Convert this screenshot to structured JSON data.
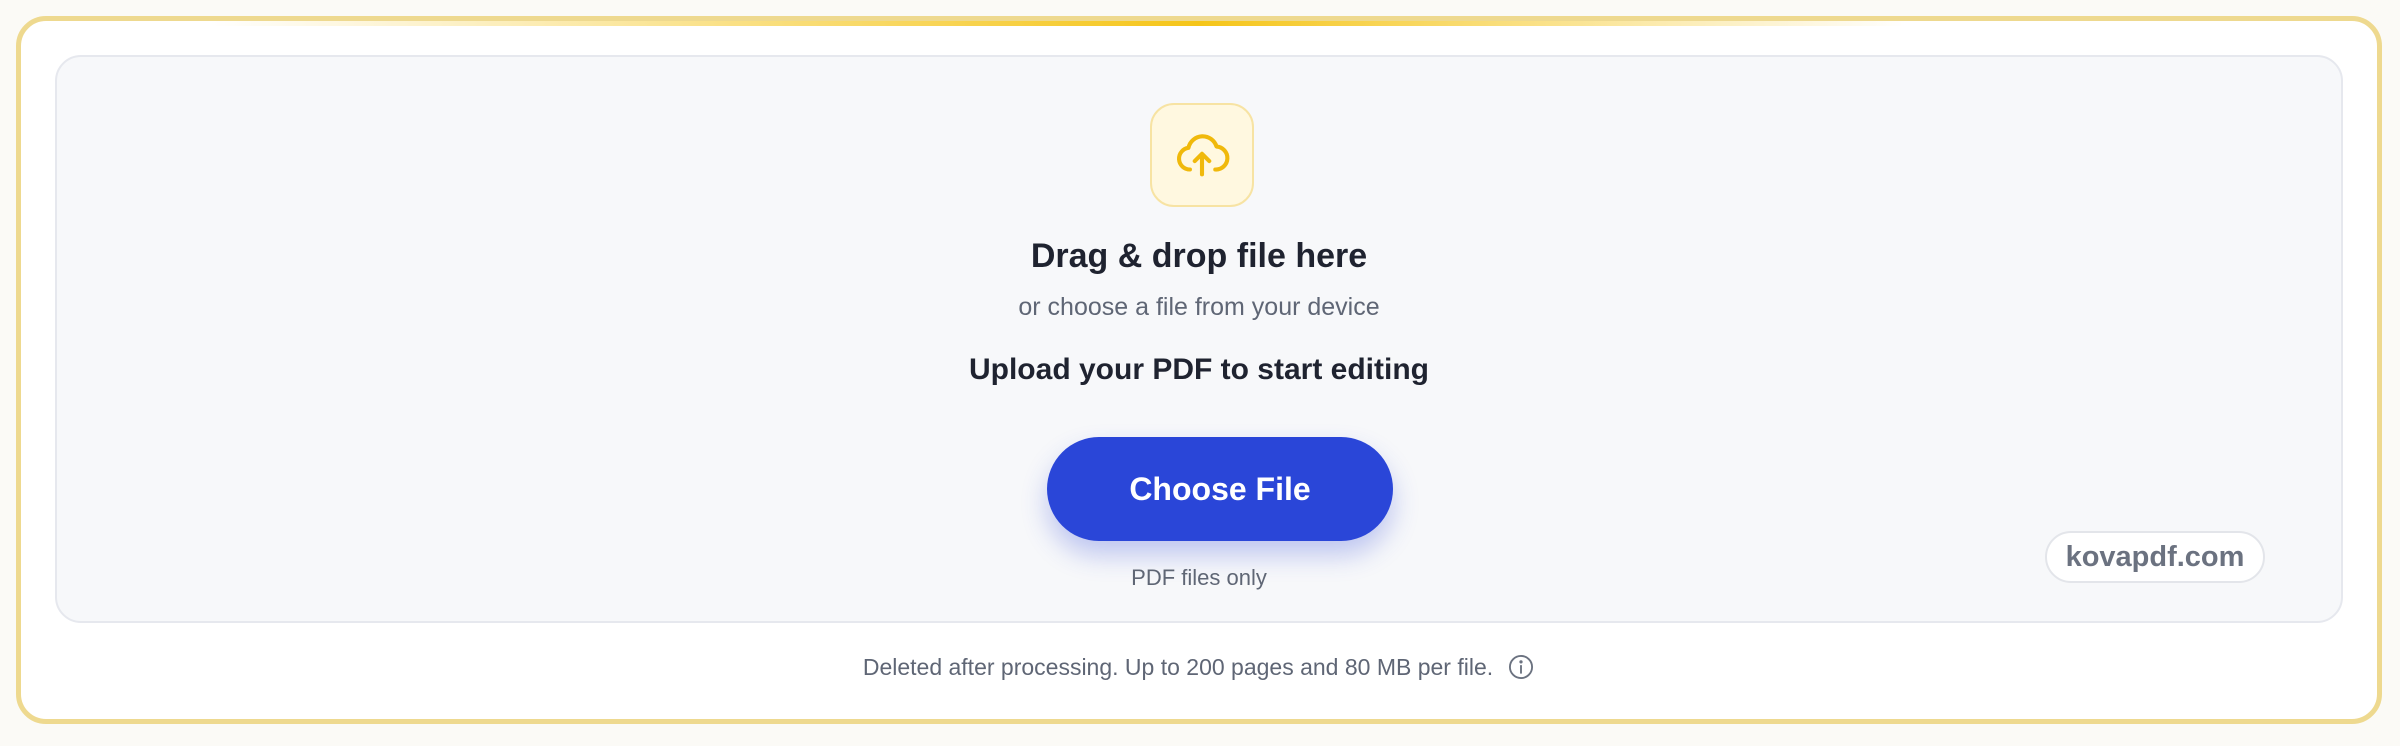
{
  "upload": {
    "icon": "cloud-upload-icon",
    "title": "Drag & drop file here",
    "subtitle": "or choose a file from your device",
    "cta": "Upload your PDF to start editing",
    "button_label": "Choose File",
    "hint": "PDF files only"
  },
  "brand": {
    "label": "kovapdf.com"
  },
  "footer": {
    "note": "Deleted after processing. Up to 200 pages and 80 MB per file.",
    "info_icon": "info-icon"
  },
  "colors": {
    "accent": "#f5c518",
    "primary": "#2a46d8",
    "border": "#eed98f"
  }
}
